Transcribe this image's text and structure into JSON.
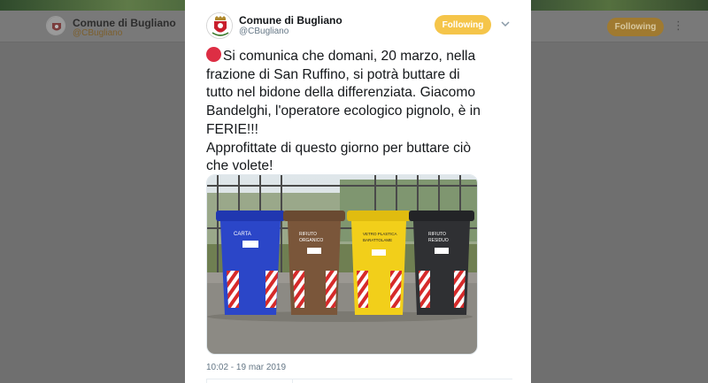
{
  "background_profile": {
    "name": "Comune di Bugliano",
    "handle": "@CBugliano",
    "follow_label": "Following",
    "more_icon": "more-vertical-icon"
  },
  "tweet": {
    "author": {
      "name": "Comune di Bugliano",
      "handle": "@CBugliano",
      "avatar_icon": "municipal-crest-icon"
    },
    "follow_label": "Following",
    "menu_icon": "chevron-down-icon",
    "text_lines": [
      "Si comunica che domani, 20 marzo, nella",
      "frazione di San Ruffino, si potrà buttare di",
      "tutto nel bidone della differenziata. Giacomo",
      "Bandelghi, l'operatore ecologico pignolo, è in",
      "FERIE!!!",
      "Approfittate di questo giorno per buttare ciò",
      "che volete!"
    ],
    "status_emoji": "red-circle-icon",
    "timestamp": "10:02 - 19 mar 2019",
    "media": {
      "bins": [
        {
          "label": "CARTA",
          "color": "#2b46c8"
        },
        {
          "label": "RIFIUTO ORGANICO",
          "color": "#7a563a"
        },
        {
          "label": "VETRO PLASTICA BARATTOLAME",
          "color": "#f2cf1a"
        },
        {
          "label": "RIFIUTO RESIDUO",
          "color": "#2f3033"
        }
      ]
    }
  },
  "colors": {
    "accent": "#f5c54a",
    "text": "#14171a",
    "muted": "#657786",
    "overlay": "#6f6f6f"
  }
}
